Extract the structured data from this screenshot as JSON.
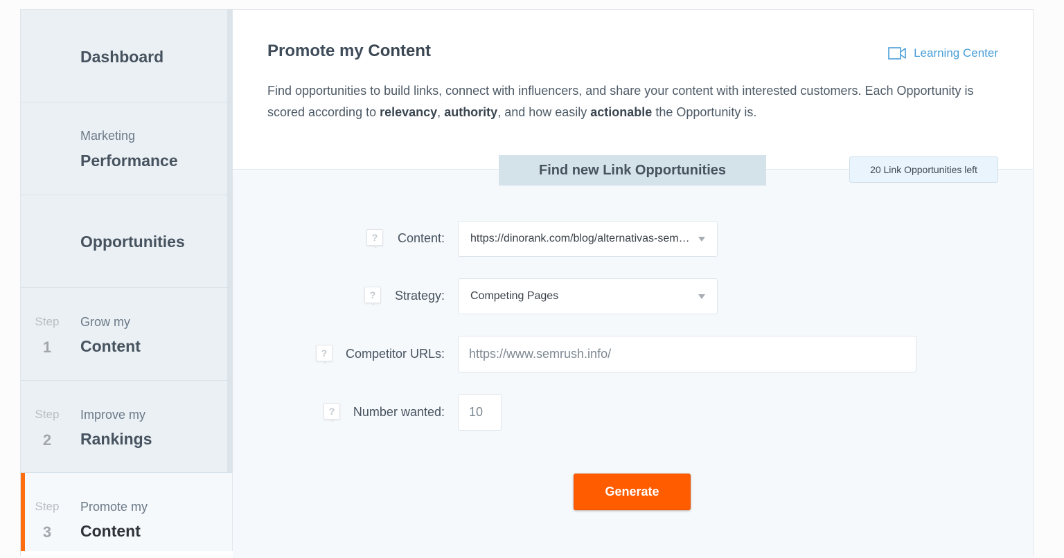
{
  "sidebar": {
    "items": [
      {
        "sub": "",
        "main": "Dashboard",
        "step": "",
        "step_num": ""
      },
      {
        "sub": "Marketing",
        "main": "Performance",
        "step": "",
        "step_num": ""
      },
      {
        "sub": "",
        "main": "Opportunities",
        "step": "",
        "step_num": ""
      },
      {
        "sub": "Grow my",
        "main": "Content",
        "step": "Step",
        "step_num": "1"
      },
      {
        "sub": "Improve my",
        "main": "Rankings",
        "step": "Step",
        "step_num": "2"
      },
      {
        "sub": "Promote my",
        "main": "Content",
        "step": "Step",
        "step_num": "3",
        "active": true
      }
    ],
    "accent_color": "#ff6d0f"
  },
  "header": {
    "title_prefix": "Promote my",
    "title_bold": "Content",
    "learning_center": {
      "label": "Learning Center",
      "icon": "video-camera-icon"
    }
  },
  "description": {
    "part1": "Find opportunities to build links, connect with influencers, and share your content with interested customers. Each Opportunity is scored according to ",
    "bold1": "relevancy",
    "sep1": ", ",
    "bold2": "authority",
    "part2": ", and how easily ",
    "bold3": "actionable",
    "part3": " the Opportunity is."
  },
  "finder": {
    "tab_label": "Find new Link Opportunities",
    "remaining_badge": "20 Link Opportunities left",
    "help_glyph": "?",
    "fields": {
      "content": {
        "label": "Content:",
        "value": "https://dinorank.com/blog/alternativas-sem…"
      },
      "strategy": {
        "label": "Strategy:",
        "value": "Competing Pages"
      },
      "competitor_urls": {
        "label": "Competitor URLs:",
        "value": "https://www.semrush.info/"
      },
      "number_wanted": {
        "label": "Number wanted:",
        "value": "10"
      }
    },
    "generate_label": "Generate",
    "generate_color": "#ff5c00"
  }
}
